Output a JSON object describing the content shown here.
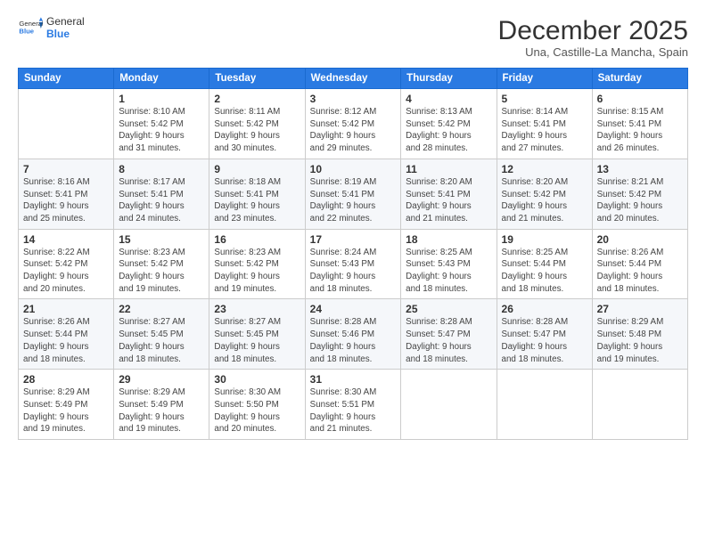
{
  "logo": {
    "general": "General",
    "blue": "Blue"
  },
  "title": "December 2025",
  "subtitle": "Una, Castille-La Mancha, Spain",
  "days_header": [
    "Sunday",
    "Monday",
    "Tuesday",
    "Wednesday",
    "Thursday",
    "Friday",
    "Saturday"
  ],
  "weeks": [
    [
      {
        "num": "",
        "info": ""
      },
      {
        "num": "1",
        "info": "Sunrise: 8:10 AM\nSunset: 5:42 PM\nDaylight: 9 hours\nand 31 minutes."
      },
      {
        "num": "2",
        "info": "Sunrise: 8:11 AM\nSunset: 5:42 PM\nDaylight: 9 hours\nand 30 minutes."
      },
      {
        "num": "3",
        "info": "Sunrise: 8:12 AM\nSunset: 5:42 PM\nDaylight: 9 hours\nand 29 minutes."
      },
      {
        "num": "4",
        "info": "Sunrise: 8:13 AM\nSunset: 5:42 PM\nDaylight: 9 hours\nand 28 minutes."
      },
      {
        "num": "5",
        "info": "Sunrise: 8:14 AM\nSunset: 5:41 PM\nDaylight: 9 hours\nand 27 minutes."
      },
      {
        "num": "6",
        "info": "Sunrise: 8:15 AM\nSunset: 5:41 PM\nDaylight: 9 hours\nand 26 minutes."
      }
    ],
    [
      {
        "num": "7",
        "info": "Sunrise: 8:16 AM\nSunset: 5:41 PM\nDaylight: 9 hours\nand 25 minutes."
      },
      {
        "num": "8",
        "info": "Sunrise: 8:17 AM\nSunset: 5:41 PM\nDaylight: 9 hours\nand 24 minutes."
      },
      {
        "num": "9",
        "info": "Sunrise: 8:18 AM\nSunset: 5:41 PM\nDaylight: 9 hours\nand 23 minutes."
      },
      {
        "num": "10",
        "info": "Sunrise: 8:19 AM\nSunset: 5:41 PM\nDaylight: 9 hours\nand 22 minutes."
      },
      {
        "num": "11",
        "info": "Sunrise: 8:20 AM\nSunset: 5:41 PM\nDaylight: 9 hours\nand 21 minutes."
      },
      {
        "num": "12",
        "info": "Sunrise: 8:20 AM\nSunset: 5:42 PM\nDaylight: 9 hours\nand 21 minutes."
      },
      {
        "num": "13",
        "info": "Sunrise: 8:21 AM\nSunset: 5:42 PM\nDaylight: 9 hours\nand 20 minutes."
      }
    ],
    [
      {
        "num": "14",
        "info": "Sunrise: 8:22 AM\nSunset: 5:42 PM\nDaylight: 9 hours\nand 20 minutes."
      },
      {
        "num": "15",
        "info": "Sunrise: 8:23 AM\nSunset: 5:42 PM\nDaylight: 9 hours\nand 19 minutes."
      },
      {
        "num": "16",
        "info": "Sunrise: 8:23 AM\nSunset: 5:42 PM\nDaylight: 9 hours\nand 19 minutes."
      },
      {
        "num": "17",
        "info": "Sunrise: 8:24 AM\nSunset: 5:43 PM\nDaylight: 9 hours\nand 18 minutes."
      },
      {
        "num": "18",
        "info": "Sunrise: 8:25 AM\nSunset: 5:43 PM\nDaylight: 9 hours\nand 18 minutes."
      },
      {
        "num": "19",
        "info": "Sunrise: 8:25 AM\nSunset: 5:44 PM\nDaylight: 9 hours\nand 18 minutes."
      },
      {
        "num": "20",
        "info": "Sunrise: 8:26 AM\nSunset: 5:44 PM\nDaylight: 9 hours\nand 18 minutes."
      }
    ],
    [
      {
        "num": "21",
        "info": "Sunrise: 8:26 AM\nSunset: 5:44 PM\nDaylight: 9 hours\nand 18 minutes."
      },
      {
        "num": "22",
        "info": "Sunrise: 8:27 AM\nSunset: 5:45 PM\nDaylight: 9 hours\nand 18 minutes."
      },
      {
        "num": "23",
        "info": "Sunrise: 8:27 AM\nSunset: 5:45 PM\nDaylight: 9 hours\nand 18 minutes."
      },
      {
        "num": "24",
        "info": "Sunrise: 8:28 AM\nSunset: 5:46 PM\nDaylight: 9 hours\nand 18 minutes."
      },
      {
        "num": "25",
        "info": "Sunrise: 8:28 AM\nSunset: 5:47 PM\nDaylight: 9 hours\nand 18 minutes."
      },
      {
        "num": "26",
        "info": "Sunrise: 8:28 AM\nSunset: 5:47 PM\nDaylight: 9 hours\nand 18 minutes."
      },
      {
        "num": "27",
        "info": "Sunrise: 8:29 AM\nSunset: 5:48 PM\nDaylight: 9 hours\nand 19 minutes."
      }
    ],
    [
      {
        "num": "28",
        "info": "Sunrise: 8:29 AM\nSunset: 5:49 PM\nDaylight: 9 hours\nand 19 minutes."
      },
      {
        "num": "29",
        "info": "Sunrise: 8:29 AM\nSunset: 5:49 PM\nDaylight: 9 hours\nand 19 minutes."
      },
      {
        "num": "30",
        "info": "Sunrise: 8:30 AM\nSunset: 5:50 PM\nDaylight: 9 hours\nand 20 minutes."
      },
      {
        "num": "31",
        "info": "Sunrise: 8:30 AM\nSunset: 5:51 PM\nDaylight: 9 hours\nand 21 minutes."
      },
      {
        "num": "",
        "info": ""
      },
      {
        "num": "",
        "info": ""
      },
      {
        "num": "",
        "info": ""
      }
    ]
  ]
}
